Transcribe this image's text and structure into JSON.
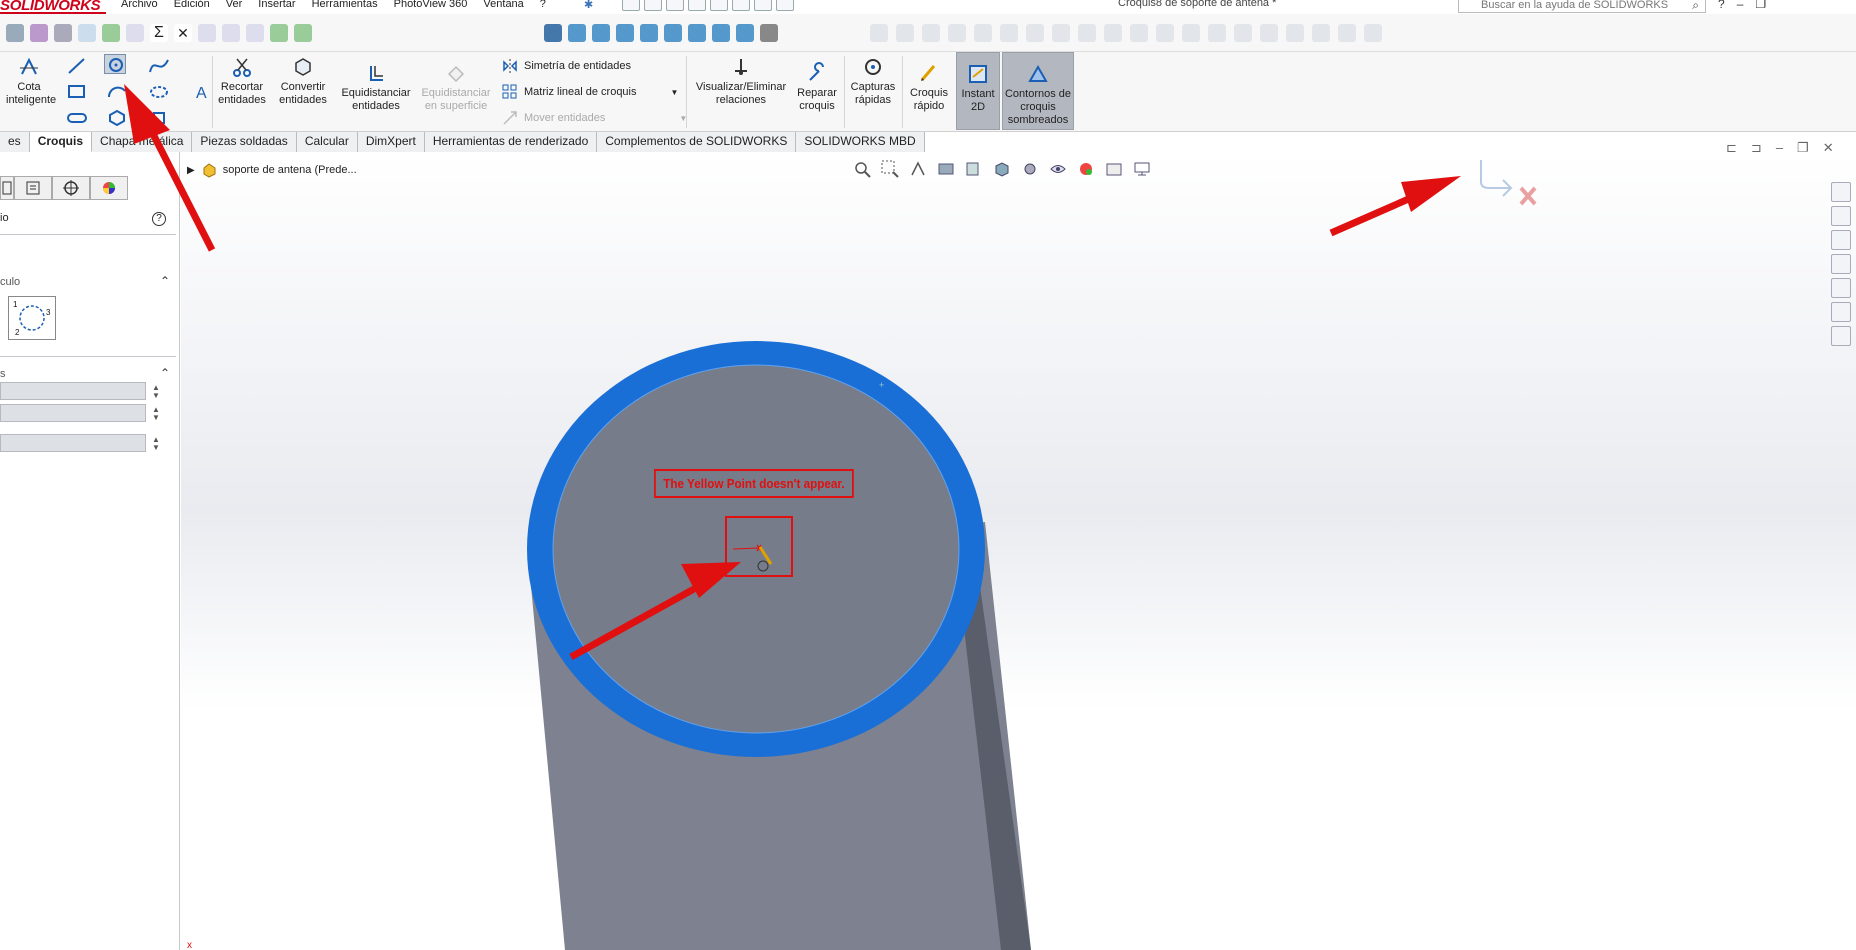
{
  "app": {
    "logo_text": "SOLIDWORKS",
    "document_title": "Croquis8 de soporte de antena *",
    "search_placeholder": "Buscar en la ayuda de SOLIDWORKS"
  },
  "menu": [
    "Archivo",
    "Edición",
    "Ver",
    "Insertar",
    "Herramientas",
    "PhotoView 360",
    "Ventana",
    "?"
  ],
  "ribbon": {
    "smart_dimension": "Cota inteligente",
    "trim": "Recortar entidades",
    "convert": "Convertir entidades",
    "offset": "Equidistanciar entidades",
    "offset_surface": "Equidistanciar en superficie",
    "mirror": "Simetría de entidades",
    "linear_pattern": "Matriz lineal de croquis",
    "move": "Mover entidades",
    "relations": "Visualizar/Eliminar relaciones",
    "repair": "Reparar croquis",
    "quick_snaps": "Capturas rápidas",
    "rapid_sketch": "Croquis rápido",
    "instant2d": "Instant 2D",
    "shaded_contours": "Contornos de croquis sombreados"
  },
  "tabs": [
    "es",
    "Croquis",
    "Chapa metálica",
    "Piezas soldadas",
    "Calcular",
    "DimXpert",
    "Herramientas de renderizado",
    "Complementos de SOLIDWORKS",
    "SOLIDWORKS MBD"
  ],
  "active_tab": "Croquis",
  "left_panel": {
    "title": "io",
    "section_circle": "culo",
    "section_params": "s"
  },
  "viewport": {
    "tree_root": "soporte de antena  (Prede...",
    "annotation": "The Yellow Point doesn't appear."
  },
  "colors": {
    "accent_red": "#e01010",
    "sketch_blue": "#1a6fd6",
    "cylinder_gray": "#7e8290"
  }
}
